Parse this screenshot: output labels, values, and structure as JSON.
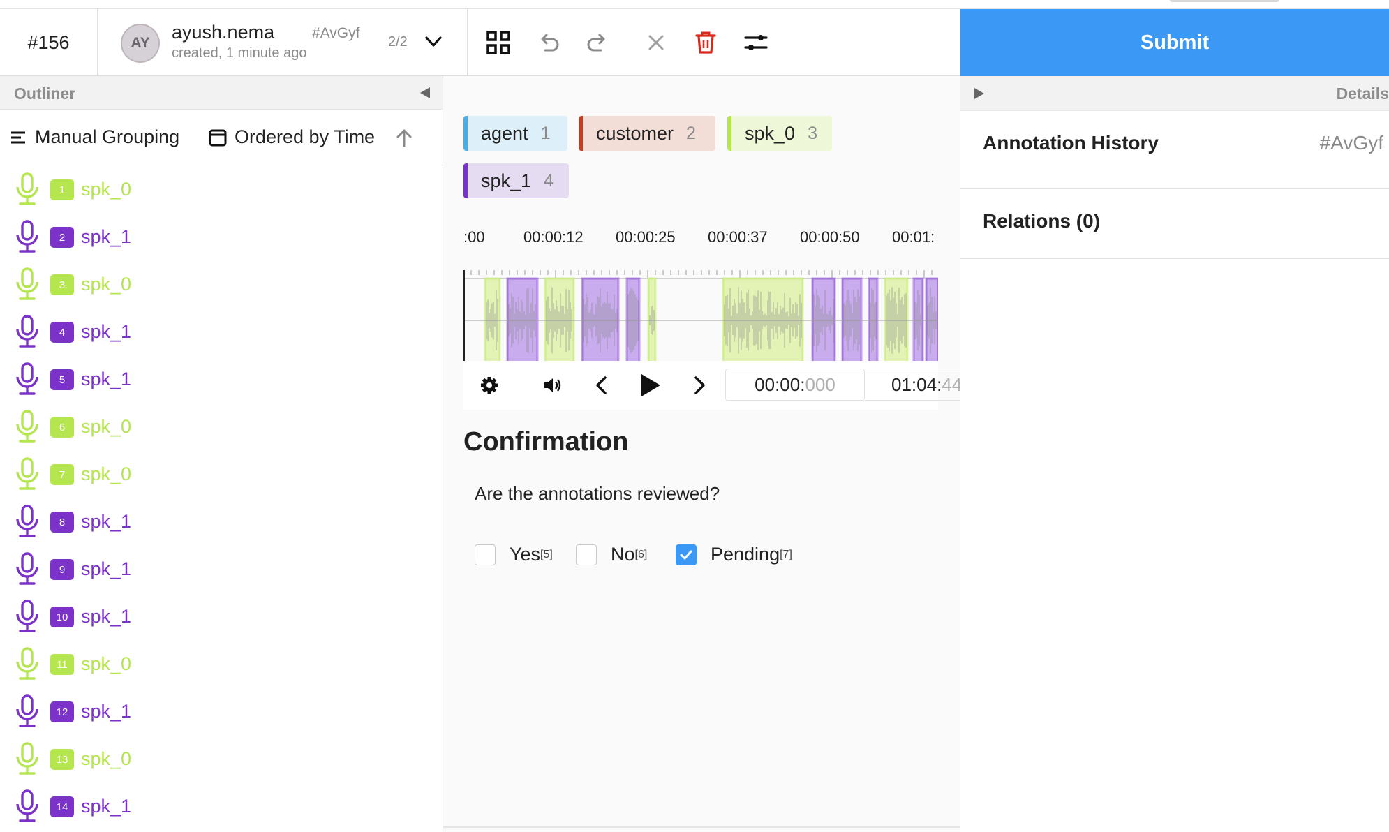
{
  "header": {
    "task_id": "#156",
    "user_initials": "AY",
    "username": "ayush.nema",
    "created": "created, 1 minute ago",
    "annotation_id": "#AvGyf",
    "annotation_count": "2/2",
    "submit_label": "Submit"
  },
  "outliner": {
    "title": "Outliner",
    "grouping_label": "Manual Grouping",
    "ordering_label": "Ordered by Time",
    "regions": [
      {
        "index": "1",
        "label": "spk_0",
        "color": "#b5e650"
      },
      {
        "index": "2",
        "label": "spk_1",
        "color": "#7b32c9"
      },
      {
        "index": "3",
        "label": "spk_0",
        "color": "#b5e650"
      },
      {
        "index": "4",
        "label": "spk_1",
        "color": "#7b32c9"
      },
      {
        "index": "5",
        "label": "spk_1",
        "color": "#7b32c9"
      },
      {
        "index": "6",
        "label": "spk_0",
        "color": "#b5e650"
      },
      {
        "index": "7",
        "label": "spk_0",
        "color": "#b5e650"
      },
      {
        "index": "8",
        "label": "spk_1",
        "color": "#7b32c9"
      },
      {
        "index": "9",
        "label": "spk_1",
        "color": "#7b32c9"
      },
      {
        "index": "10",
        "label": "spk_1",
        "color": "#7b32c9"
      },
      {
        "index": "11",
        "label": "spk_0",
        "color": "#b5e650"
      },
      {
        "index": "12",
        "label": "spk_1",
        "color": "#7b32c9"
      },
      {
        "index": "13",
        "label": "spk_0",
        "color": "#b5e650"
      },
      {
        "index": "14",
        "label": "spk_1",
        "color": "#7b32c9"
      }
    ]
  },
  "labels": [
    {
      "name": "agent",
      "hotkey": "1",
      "color": "#4aaee3",
      "bg": "#ddeff8"
    },
    {
      "name": "customer",
      "hotkey": "2",
      "color": "#c23d21",
      "bg": "#f3ddd7"
    },
    {
      "name": "spk_0",
      "hotkey": "3",
      "color": "#b5e650",
      "bg": "#eef8d8"
    },
    {
      "name": "spk_1",
      "hotkey": "4",
      "color": "#7b32c9",
      "bg": "#e6dcf1"
    }
  ],
  "audio": {
    "timeline_ticks": [
      ":00",
      "00:00:12",
      "00:00:25",
      "00:00:37",
      "00:00:50",
      "00:01:"
    ],
    "current_time": "00:00:",
    "current_ms": "000",
    "total_time": "01:04:",
    "total_ms": "44"
  },
  "confirmation": {
    "title": "Confirmation",
    "question": "Are the annotations reviewed?",
    "choices": [
      {
        "label": "Yes",
        "hotkey": "[5]",
        "checked": false
      },
      {
        "label": "No",
        "hotkey": "[6]",
        "checked": false
      },
      {
        "label": "Pending",
        "hotkey": "[7]",
        "checked": true
      }
    ]
  },
  "details": {
    "title": "Details",
    "history_title": "Annotation History",
    "history_id": "#AvGyf",
    "relations_title": "Relations (0)"
  },
  "colors": {
    "accent": "#3b98f5",
    "delete": "#d9291c",
    "spk_0": "#b5e650",
    "spk_1": "#7b32c9"
  }
}
